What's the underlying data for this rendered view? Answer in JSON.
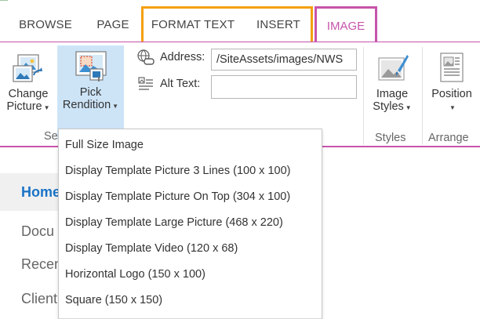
{
  "tabs": {
    "browse": "BROWSE",
    "page": "PAGE",
    "format_text": "FORMAT TEXT",
    "insert": "INSERT",
    "image": "IMAGE"
  },
  "ribbon": {
    "change_picture": {
      "line1": "Change",
      "line2": "Picture",
      "icon": "change-picture-icon"
    },
    "pick_rendition": {
      "line1": "Pick",
      "line2": "Rendition",
      "icon": "pick-rendition-icon"
    },
    "address": {
      "label": "Address:",
      "value": "/SiteAssets/images/NWS",
      "icon": "address-link-icon"
    },
    "alt_text": {
      "label": "Alt Text:",
      "value": "",
      "icon": "alt-text-icon"
    },
    "image_styles": {
      "line1": "Image",
      "line2": "Styles",
      "icon": "image-styles-icon"
    },
    "position": {
      "line1": "Position",
      "icon": "position-icon"
    },
    "groups": {
      "select_partial": "Se",
      "styles": "Styles",
      "arrange": "Arrange"
    }
  },
  "nav": {
    "home": "Home",
    "documents": "Docu",
    "recent": "Recen",
    "clients": "Client"
  },
  "rendition_menu": [
    "Full Size Image",
    "Display Template Picture 3 Lines (100 x 100)",
    "Display Template Picture On Top (304 x 100)",
    "Display Template Large Picture (468 x 220)",
    "Display Template Video (120 x 68)",
    "Horizontal Logo (150 x 100)",
    "Square (150 x 150)"
  ],
  "colors": {
    "image_tab": "#c654aa",
    "insert_group": "#f4a00f",
    "selected_button": "#cde4f7",
    "home_link": "#1a73c6"
  }
}
